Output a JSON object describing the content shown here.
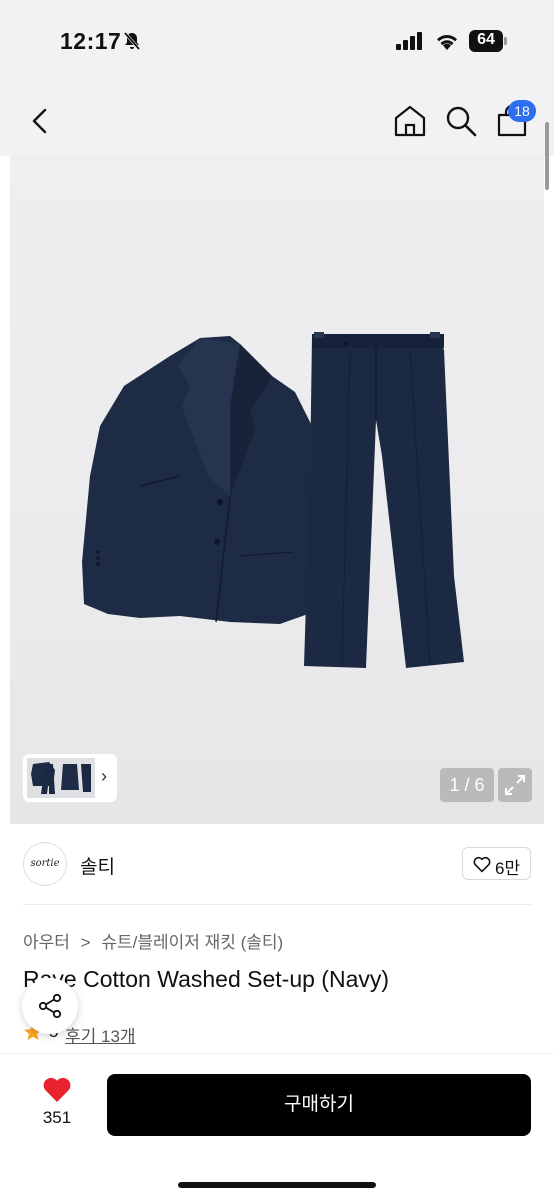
{
  "status_bar": {
    "time": "12:17",
    "battery": "64"
  },
  "nav": {
    "cart_count": "18",
    "icons": [
      "back-icon",
      "home-icon",
      "search-icon",
      "bag-icon"
    ]
  },
  "gallery": {
    "page_counter": "1 / 6",
    "thumb_chevron": "›"
  },
  "brand": {
    "logo_text": "sortie",
    "name": "솔티",
    "likes": "6만"
  },
  "breadcrumb": {
    "category": "아우터",
    "separator": ">",
    "subcategory": "슈트/블레이저 재킷 (솔티)"
  },
  "product": {
    "title": "Rave Cotton Washed Set-up (Navy)",
    "rating": "5",
    "reviews": "후기 13개"
  },
  "bottom_bar": {
    "like_count": "351",
    "buy_label": "구매하기"
  },
  "colors": {
    "accent_blue": "#2d6ef0",
    "heart_red": "#e8232d",
    "navy": "#1e2b45",
    "star": "#f5a623"
  }
}
